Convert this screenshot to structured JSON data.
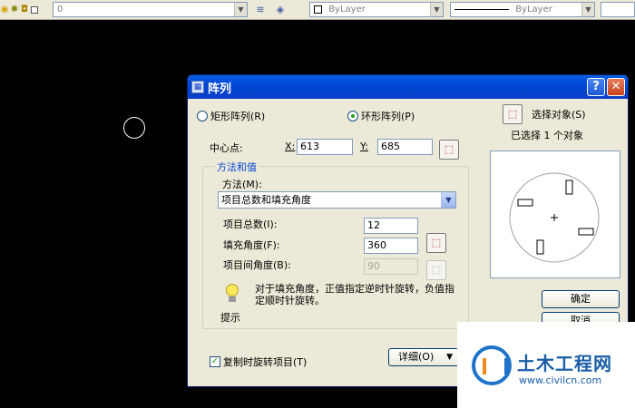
{
  "toolbar": {
    "layer_value": "0",
    "color_value": "ByLayer",
    "linetype_value": "ByLayer"
  },
  "dialog": {
    "title": "阵列",
    "help_label": "?",
    "close_label": "✕",
    "rect_array_label": "矩形阵列(R)",
    "polar_array_label": "环形阵列(P)",
    "selected_mode": "polar",
    "select_objects_label": "选择对象(S)",
    "selected_count_label": "已选择 1 个对象",
    "center_point_label": "中心点:",
    "x_label": "X:",
    "x_value": "613",
    "y_label": "Y:",
    "y_value": "685",
    "method_group_label": "方法和值",
    "method_label": "方法(M):",
    "method_value": "项目总数和填充角度",
    "total_items_label": "项目总数(I):",
    "total_items_value": "12",
    "fill_angle_label": "填充角度(F):",
    "fill_angle_value": "360",
    "item_angle_label": "项目间角度(B):",
    "item_angle_value": "90",
    "tip_text": "对于填充角度，正值指定逆时针旋转，负值指定顺时针旋转。",
    "tip_label": "提示",
    "ok_label": "确定",
    "cancel_label": "取消",
    "rotate_items_label": "复制时旋转项目(T)",
    "rotate_items_checked": true,
    "details_label": "详细(O)"
  },
  "watermark": {
    "title": "土木工程网",
    "url": "www.civilcn.com"
  },
  "colors": {
    "title_bar": "#0046d5",
    "dialog_bg": "#ece9d8",
    "legend_text": "#0046d5"
  }
}
